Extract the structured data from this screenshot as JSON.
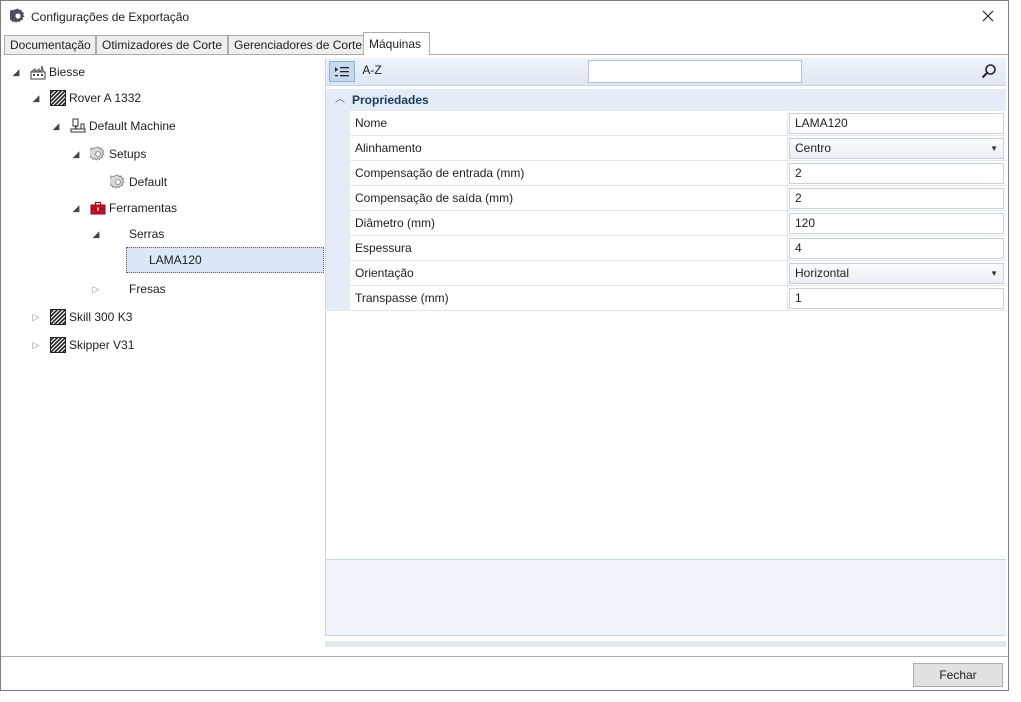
{
  "window": {
    "title": "Configurações de Exportação",
    "icon": "gear-icon"
  },
  "tabs": [
    {
      "label": "Documentação",
      "active": false
    },
    {
      "label": "Otimizadores de Corte",
      "active": false
    },
    {
      "label": "Gerenciadores de Corte",
      "active": false
    },
    {
      "label": "Máquinas",
      "active": true
    }
  ],
  "tree": {
    "nodes": [
      {
        "label": "Biesse",
        "level": 0,
        "expanded": true,
        "icon": "factory-icon"
      },
      {
        "label": "Rover A 1332",
        "level": 1,
        "expanded": true,
        "icon": "machine-hatch-icon"
      },
      {
        "label": "Default Machine",
        "level": 2,
        "expanded": true,
        "icon": "cnc-machine-icon"
      },
      {
        "label": "Setups",
        "level": 3,
        "expanded": true,
        "icon": "cog-icon"
      },
      {
        "label": "Default",
        "level": 4,
        "expanded": null,
        "icon": "cog-icon"
      },
      {
        "label": "Ferramentas",
        "level": 3,
        "expanded": true,
        "icon": "toolbox-icon"
      },
      {
        "label": "Serras",
        "level": 4,
        "expanded": true,
        "icon": ""
      },
      {
        "label": "LAMA120",
        "level": 5,
        "expanded": null,
        "icon": "",
        "selected": true
      },
      {
        "label": "Fresas",
        "level": 4,
        "expanded": false,
        "icon": ""
      },
      {
        "label": "Skill 300 K3",
        "level": 1,
        "expanded": false,
        "icon": "machine-hatch-icon"
      },
      {
        "label": "Skipper V31",
        "level": 1,
        "expanded": false,
        "icon": "machine-hatch-icon"
      }
    ]
  },
  "property_grid": {
    "toolbar": {
      "categorized_icon": "categorized-list-icon",
      "alphabetical_label": "A-Z",
      "search_value": "",
      "search_icon": "search-icon"
    },
    "category": "Propriedades",
    "properties": [
      {
        "name": "Nome",
        "value": "LAMA120",
        "type": "text"
      },
      {
        "name": "Alinhamento",
        "value": "Centro",
        "type": "combo"
      },
      {
        "name": "Compensação de entrada (mm)",
        "value": "2",
        "type": "text"
      },
      {
        "name": "Compensação de saída (mm)",
        "value": "2",
        "type": "text"
      },
      {
        "name": "Diâmetro (mm)",
        "value": "120",
        "type": "text"
      },
      {
        "name": "Espessura",
        "value": "4",
        "type": "text"
      },
      {
        "name": "Orientação",
        "value": "Horizontal",
        "type": "combo"
      },
      {
        "name": "Transpasse (mm)",
        "value": "1",
        "type": "text"
      }
    ]
  },
  "footer": {
    "close_label": "Fechar"
  },
  "colors": {
    "selection": "#dbe8f7",
    "category_band": "#e4ecf7",
    "toolbox_red": "#c8102e"
  }
}
